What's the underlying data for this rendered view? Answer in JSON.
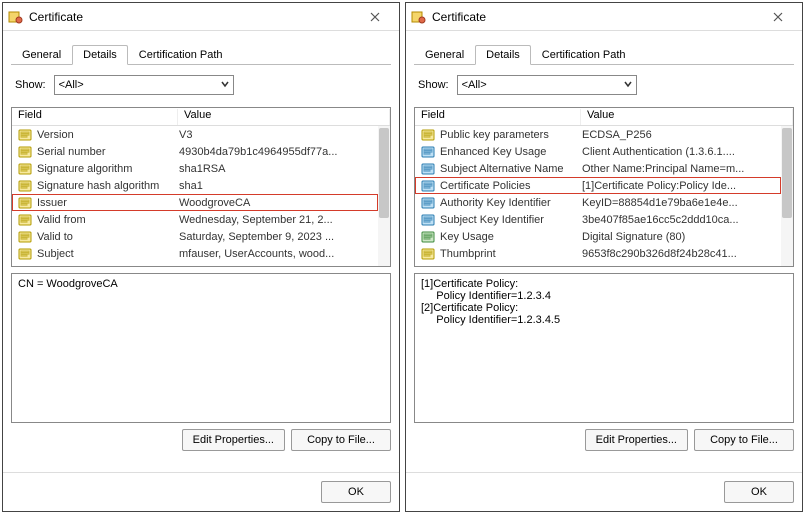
{
  "windows": [
    {
      "title": "Certificate",
      "tabs": {
        "general": "General",
        "details": "Details",
        "path": "Certification Path"
      },
      "show_label": "Show:",
      "show_value": "<All>",
      "columns": {
        "field": "Field",
        "value": "Value"
      },
      "rows": [
        {
          "icon": "y",
          "field": "Version",
          "value": "V3",
          "sel": false
        },
        {
          "icon": "y",
          "field": "Serial number",
          "value": "4930b4da79b1c4964955df77a...",
          "sel": false
        },
        {
          "icon": "y",
          "field": "Signature algorithm",
          "value": "sha1RSA",
          "sel": false
        },
        {
          "icon": "y",
          "field": "Signature hash algorithm",
          "value": "sha1",
          "sel": false
        },
        {
          "icon": "y",
          "field": "Issuer",
          "value": "WoodgroveCA",
          "sel": true
        },
        {
          "icon": "y",
          "field": "Valid from",
          "value": "Wednesday, September 21, 2...",
          "sel": false
        },
        {
          "icon": "y",
          "field": "Valid to",
          "value": "Saturday, September 9, 2023 ...",
          "sel": false
        },
        {
          "icon": "y",
          "field": "Subject",
          "value": "mfauser, UserAccounts, wood...",
          "sel": false
        }
      ],
      "detail_text": "CN = WoodgroveCA",
      "buttons": {
        "edit": "Edit Properties...",
        "copy": "Copy to File...",
        "ok": "OK"
      }
    },
    {
      "title": "Certificate",
      "tabs": {
        "general": "General",
        "details": "Details",
        "path": "Certification Path"
      },
      "show_label": "Show:",
      "show_value": "<All>",
      "columns": {
        "field": "Field",
        "value": "Value"
      },
      "rows": [
        {
          "icon": "y",
          "field": "Public key parameters",
          "value": "ECDSA_P256",
          "sel": false
        },
        {
          "icon": "b",
          "field": "Enhanced Key Usage",
          "value": "Client Authentication (1.3.6.1....",
          "sel": false
        },
        {
          "icon": "b",
          "field": "Subject Alternative Name",
          "value": "Other Name:Principal Name=m...",
          "sel": false
        },
        {
          "icon": "b",
          "field": "Certificate Policies",
          "value": "[1]Certificate Policy:Policy Ide...",
          "sel": true
        },
        {
          "icon": "b",
          "field": "Authority Key Identifier",
          "value": "KeyID=88854d1e79ba6e1e4e...",
          "sel": false
        },
        {
          "icon": "b",
          "field": "Subject Key Identifier",
          "value": "3be407f85ae16cc5c2ddd10ca...",
          "sel": false
        },
        {
          "icon": "g",
          "field": "Key Usage",
          "value": "Digital Signature (80)",
          "sel": false
        },
        {
          "icon": "y",
          "field": "Thumbprint",
          "value": "9653f8c290b326d8f24b28c41...",
          "sel": false
        }
      ],
      "detail_text": "[1]Certificate Policy:\n     Policy Identifier=1.2.3.4\n[2]Certificate Policy:\n     Policy Identifier=1.2.3.4.5",
      "buttons": {
        "edit": "Edit Properties...",
        "copy": "Copy to File...",
        "ok": "OK"
      }
    }
  ]
}
